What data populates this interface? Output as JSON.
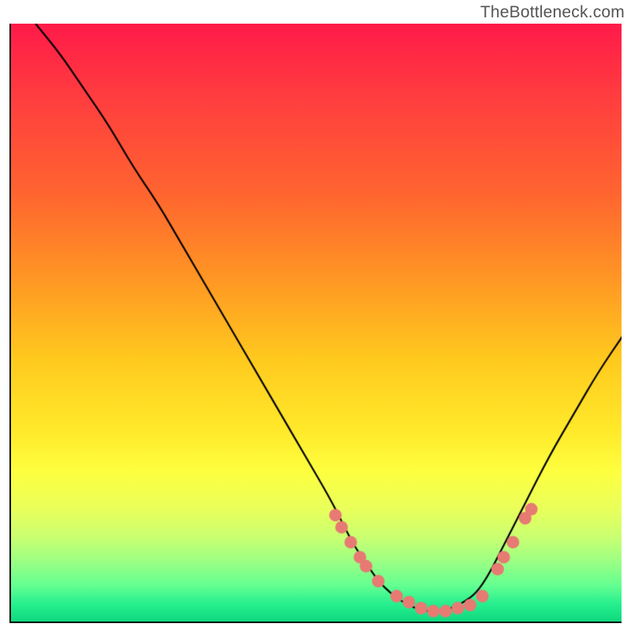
{
  "watermark": "TheBottleneck.com",
  "colors": {
    "curve_stroke": "#000000",
    "marker_fill": "#e77a73",
    "gradient_top": "#ff1a49",
    "gradient_mid": "#ffe92a",
    "gradient_bottom": "#0fd97f"
  },
  "chart_data": {
    "type": "line",
    "title": "",
    "xlabel": "",
    "ylabel": "",
    "xlim": [
      0,
      100
    ],
    "ylim": [
      0,
      100
    ],
    "series": [
      {
        "name": "bottleneck-curve",
        "x": [
          4,
          8,
          12,
          16,
          20,
          24,
          28,
          32,
          36,
          40,
          44,
          48,
          52,
          54,
          56,
          58,
          60,
          62,
          64,
          66,
          68,
          70,
          72,
          74,
          76,
          78,
          80,
          84,
          88,
          92,
          96,
          100
        ],
        "y": [
          100,
          95,
          89,
          83,
          76,
          70,
          63,
          56,
          49,
          42,
          35,
          28,
          21,
          17,
          13,
          10,
          7,
          5,
          3.5,
          2.5,
          2,
          2,
          2.5,
          3.5,
          5,
          8,
          12,
          20,
          28,
          35,
          42,
          48
        ]
      }
    ],
    "markers": {
      "name": "scatter-dots",
      "x": [
        53,
        54,
        55.5,
        57,
        58,
        60,
        63,
        65,
        67,
        69,
        71,
        73,
        75,
        77,
        79.5,
        80.5,
        82,
        84,
        85
      ],
      "y": [
        18,
        16,
        13.5,
        11,
        9.5,
        7,
        4.5,
        3.5,
        2.5,
        2,
        2,
        2.5,
        3,
        4.5,
        9,
        11,
        13.5,
        17.5,
        19
      ]
    }
  }
}
